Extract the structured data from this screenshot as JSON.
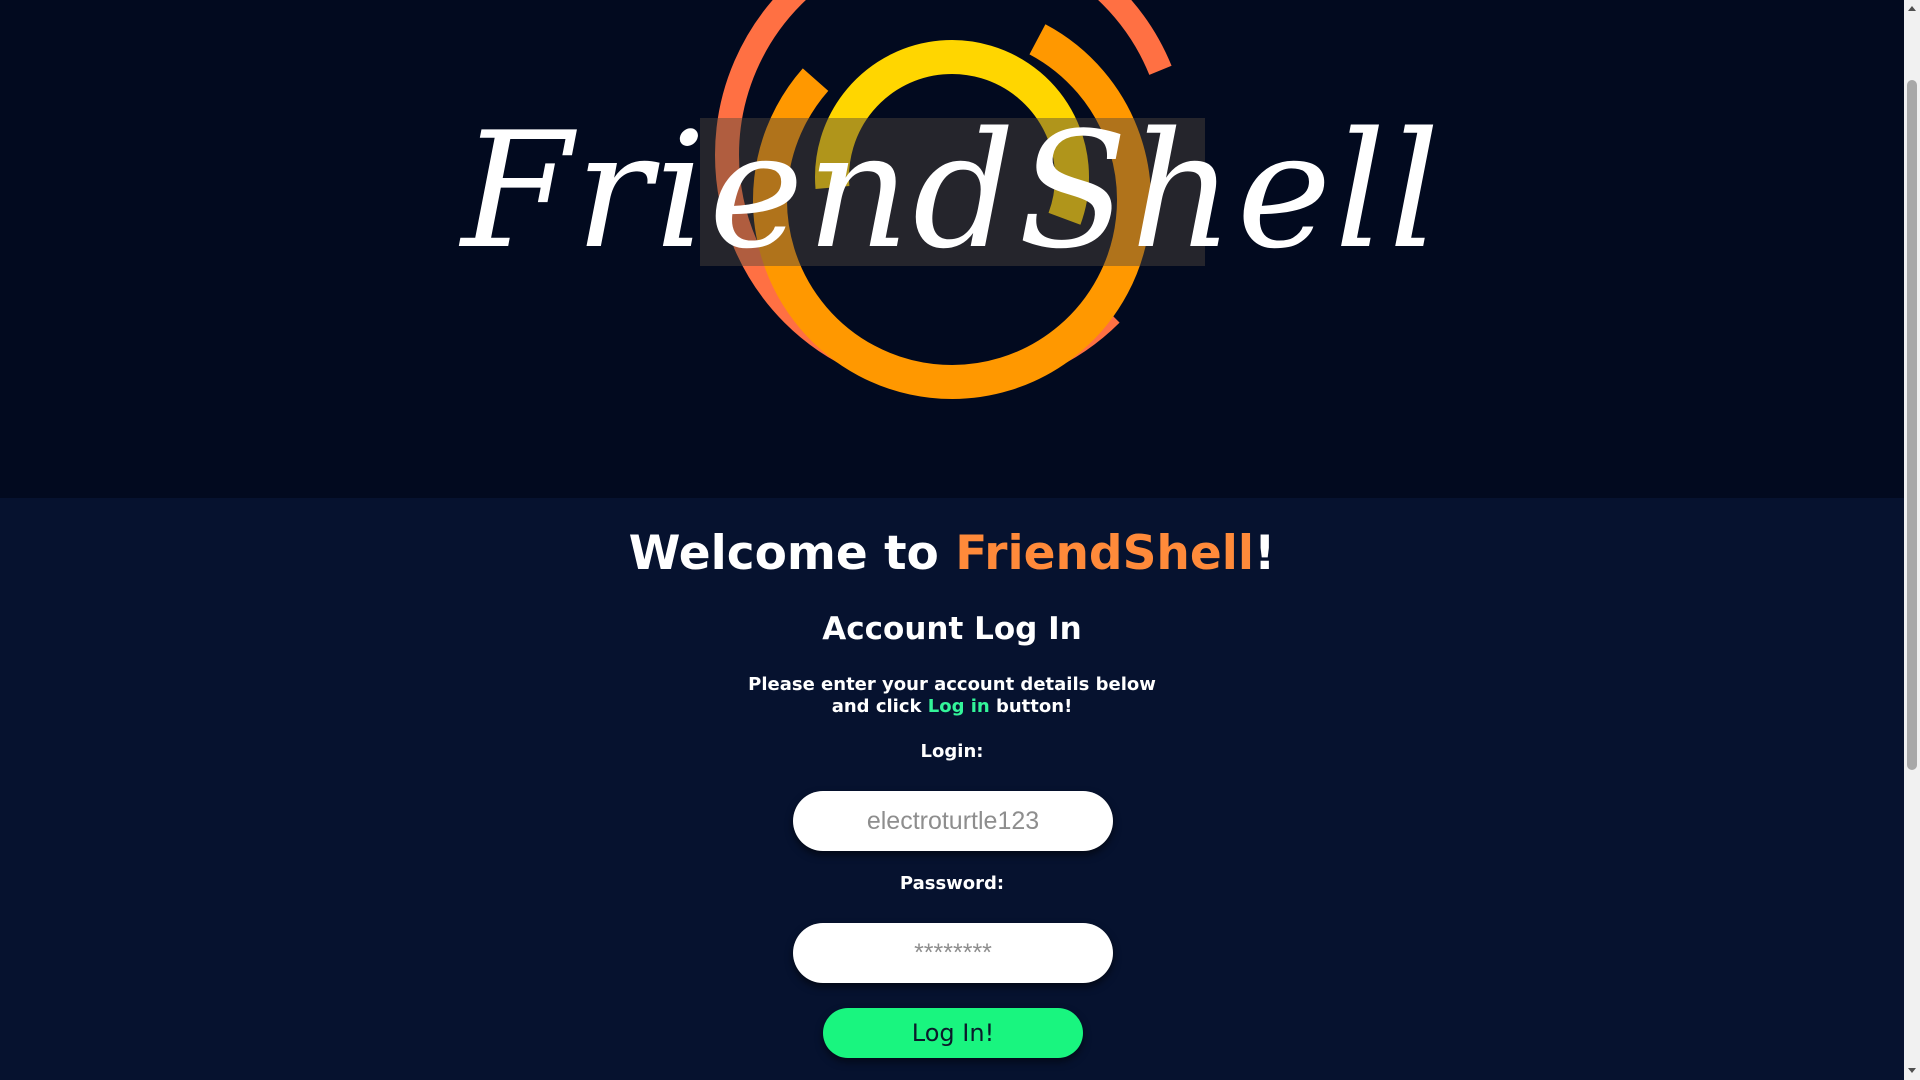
{
  "logo": {
    "text": "FriendShell",
    "colors": {
      "outer_ring": "#ff7043",
      "middle_ring": "#ff9800",
      "inner_ring": "#ffd600",
      "band": "rgba(80,70,60,0.45)"
    }
  },
  "welcome": {
    "prefix": "Welcome to ",
    "brand": "FriendShell",
    "suffix": "!"
  },
  "subtitle": "Account Log In",
  "instructions": {
    "line1": "Please enter your account details below",
    "line2_prefix": "and click ",
    "line2_highlight": "Log in",
    "line2_suffix": " button!"
  },
  "form": {
    "login_label": "Login:",
    "login_placeholder": "electroturtle123",
    "password_label": "Password:",
    "password_placeholder": "********",
    "submit_label": "Log In!"
  },
  "colors": {
    "hero_background": "#020a1f",
    "page_background": "#06122f",
    "brand_accent": "#ff8a3a",
    "highlight_green": "#33f59a",
    "button_green": "#19f57f"
  }
}
